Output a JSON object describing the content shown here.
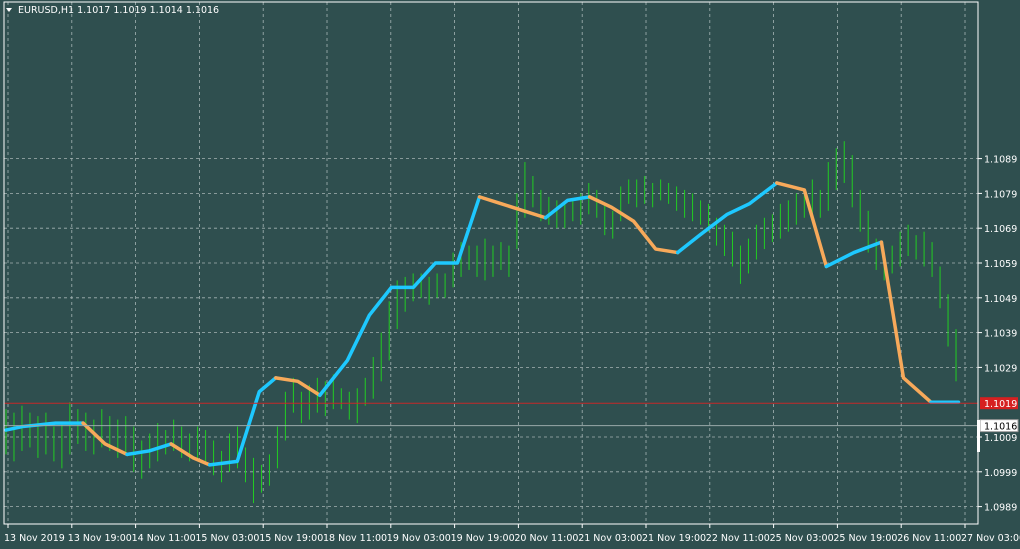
{
  "header": {
    "dropdown_icon": "triangle-down-icon",
    "text": "EURUSD,H1  1.1017 1.1019 1.1014 1.1016"
  },
  "colors": {
    "background": "#2f4f4f",
    "grid": "#a5b4b4",
    "frame": "#ffffff",
    "candles": "#22cc22",
    "trend_up": "#1ec8ff",
    "trend_down": "#f7a95a",
    "current_price_line": "#c62828",
    "current_price_badge": "#d62020",
    "last_price_line": "#9aaaaa"
  },
  "price_badges": {
    "current": "1.1019",
    "last": "1.1016"
  },
  "chart_data": {
    "type": "line",
    "symbol": "EURUSD",
    "timeframe": "H1",
    "ohlc_header": {
      "open": 1.1017,
      "high": 1.1019,
      "low": 1.1014,
      "close": 1.1016
    },
    "ylim": [
      1.0984,
      1.1134
    ],
    "y_ticks": [
      "1.1089",
      "1.1079",
      "1.1069",
      "1.1059",
      "1.1049",
      "1.1039",
      "1.1029",
      "1.1009",
      "1.0999",
      "1.0989"
    ],
    "x_ticks": [
      "13 Nov 2019",
      "13 Nov 19:00",
      "14 Nov 11:00",
      "15 Nov 03:00",
      "15 Nov 19:00",
      "18 Nov 11:00",
      "19 Nov 03:00",
      "19 Nov 19:00",
      "20 Nov 11:00",
      "21 Nov 03:00",
      "21 Nov 19:00",
      "22 Nov 11:00",
      "25 Nov 03:00",
      "25 Nov 19:00",
      "26 Nov 11:00",
      "27 Nov 03:00"
    ],
    "grid": true,
    "horizontal_lines": [
      {
        "name": "current price",
        "value": 1.1019
      },
      {
        "name": "last price",
        "value": 1.1016
      }
    ],
    "candle_count": 120,
    "candle_ranges": [
      [
        1.1004,
        1.1017
      ],
      [
        1.1002,
        1.1016
      ],
      [
        1.1005,
        1.1018
      ],
      [
        1.1006,
        1.1016
      ],
      [
        1.1003,
        1.1015
      ],
      [
        1.1004,
        1.1016
      ],
      [
        1.1002,
        1.1012
      ],
      [
        1.1,
        1.1013
      ],
      [
        1.1004,
        1.1019
      ],
      [
        1.1007,
        1.1017
      ],
      [
        1.1005,
        1.1016
      ],
      [
        1.1004,
        1.1014
      ],
      [
        1.1006,
        1.1017
      ],
      [
        1.1005,
        1.1015
      ],
      [
        1.1003,
        1.1014
      ],
      [
        1.1004,
        1.1015
      ],
      [
        1.0999,
        1.1012
      ],
      [
        1.0997,
        1.1008
      ],
      [
        1.1,
        1.101
      ],
      [
        1.1002,
        1.1013
      ],
      [
        1.1004,
        1.1011
      ],
      [
        1.1005,
        1.1014
      ],
      [
        1.1003,
        1.1012
      ],
      [
        1.1002,
        1.101
      ],
      [
        1.1003,
        1.1012
      ],
      [
        1.1002,
        1.1011
      ],
      [
        1.0998,
        1.1008
      ],
      [
        1.0996,
        1.1005
      ],
      [
        1.0999,
        1.101
      ],
      [
        1.1,
        1.1012
      ],
      [
        1.0996,
        1.1006
      ],
      [
        1.099,
        1.1003
      ],
      [
        1.0993,
        1.1001
      ],
      [
        1.0995,
        1.1004
      ],
      [
        1.1,
        1.1012
      ],
      [
        1.1008,
        1.1022
      ],
      [
        1.1016,
        1.1026
      ],
      [
        1.1013,
        1.1022
      ],
      [
        1.1014,
        1.1024
      ],
      [
        1.1016,
        1.1026
      ],
      [
        1.1015,
        1.1025
      ],
      [
        1.1017,
        1.1027
      ],
      [
        1.1017,
        1.1023
      ],
      [
        1.1014,
        1.1022
      ],
      [
        1.1013,
        1.1023
      ],
      [
        1.1018,
        1.1026
      ],
      [
        1.102,
        1.1032
      ],
      [
        1.1025,
        1.1039
      ],
      [
        1.1031,
        1.1048
      ],
      [
        1.104,
        1.1054
      ],
      [
        1.1045,
        1.1055
      ],
      [
        1.1048,
        1.1056
      ],
      [
        1.1049,
        1.1056
      ],
      [
        1.1047,
        1.1055
      ],
      [
        1.1049,
        1.1056
      ],
      [
        1.1049,
        1.1056
      ],
      [
        1.1052,
        1.1062
      ],
      [
        1.1055,
        1.1065
      ],
      [
        1.1057,
        1.1064
      ],
      [
        1.1055,
        1.1064
      ],
      [
        1.1054,
        1.1066
      ],
      [
        1.1055,
        1.1064
      ],
      [
        1.1057,
        1.1065
      ],
      [
        1.1055,
        1.1064
      ],
      [
        1.1063,
        1.1079
      ],
      [
        1.1072,
        1.1088
      ],
      [
        1.1075,
        1.1084
      ],
      [
        1.1071,
        1.108
      ],
      [
        1.107,
        1.1078
      ],
      [
        1.1069,
        1.1077
      ],
      [
        1.1069,
        1.1076
      ],
      [
        1.1071,
        1.1077
      ],
      [
        1.107,
        1.1079
      ],
      [
        1.1073,
        1.1082
      ],
      [
        1.1072,
        1.108
      ],
      [
        1.1067,
        1.1076
      ],
      [
        1.1066,
        1.1074
      ],
      [
        1.1071,
        1.1081
      ],
      [
        1.1076,
        1.1083
      ],
      [
        1.1075,
        1.1083
      ],
      [
        1.1076,
        1.1084
      ],
      [
        1.1075,
        1.1082
      ],
      [
        1.1077,
        1.1083
      ],
      [
        1.1076,
        1.1082
      ],
      [
        1.1074,
        1.1081
      ],
      [
        1.1072,
        1.108
      ],
      [
        1.1071,
        1.1079
      ],
      [
        1.107,
        1.1077
      ],
      [
        1.1068,
        1.1076
      ],
      [
        1.1064,
        1.1072
      ],
      [
        1.1061,
        1.107
      ],
      [
        1.1058,
        1.1068
      ],
      [
        1.1053,
        1.1064
      ],
      [
        1.1056,
        1.1066
      ],
      [
        1.106,
        1.107
      ],
      [
        1.1063,
        1.1072
      ],
      [
        1.1065,
        1.1073
      ],
      [
        1.1066,
        1.1076
      ],
      [
        1.1068,
        1.1077
      ],
      [
        1.107,
        1.1079
      ],
      [
        1.1072,
        1.108
      ],
      [
        1.1073,
        1.1083
      ],
      [
        1.1072,
        1.108
      ],
      [
        1.1074,
        1.1088
      ],
      [
        1.108,
        1.1092
      ],
      [
        1.1082,
        1.1094
      ],
      [
        1.1075,
        1.109
      ],
      [
        1.1068,
        1.108
      ],
      [
        1.1062,
        1.1074
      ],
      [
        1.1057,
        1.1066
      ],
      [
        1.1054,
        1.1062
      ],
      [
        1.1056,
        1.1064
      ],
      [
        1.1058,
        1.1068
      ],
      [
        1.1061,
        1.107
      ],
      [
        1.106,
        1.1067
      ],
      [
        1.1058,
        1.1068
      ],
      [
        1.1055,
        1.1065
      ],
      [
        1.1046,
        1.1058
      ],
      [
        1.1035,
        1.105
      ],
      [
        1.1025,
        1.104
      ]
    ],
    "series": [
      {
        "x_index": [
          0,
          3,
          9,
          14,
          18,
          22,
          26,
          30,
          34,
          37,
          42,
          46,
          49,
          53,
          57,
          62,
          66,
          70,
          74,
          78,
          82,
          86,
          90,
          94,
          98,
          102,
          106,
          110,
          114,
          118,
          122,
          126,
          131,
          135,
          140,
          145,
          149,
          154,
          159,
          163,
          168,
          173
        ],
        "values": [
          1.1011,
          1.1012,
          1.1013,
          1.1013,
          1.1007,
          1.1004,
          1.1005,
          1.1007,
          1.1003,
          1.1001,
          1.1002,
          1.1022,
          1.1026,
          1.1025,
          1.1021,
          1.1031,
          1.1044,
          1.1052,
          1.1052,
          1.1059,
          1.1059,
          1.1078,
          1.1076,
          1.1074,
          1.1072,
          1.1077,
          1.1078,
          1.1075,
          1.1071,
          1.1063,
          1.1062,
          1.1067,
          1.1073,
          1.1076,
          1.1082,
          1.108,
          1.1058,
          1.1062,
          1.1065,
          1.1026,
          1.1019,
          1.1019
        ]
      }
    ]
  }
}
